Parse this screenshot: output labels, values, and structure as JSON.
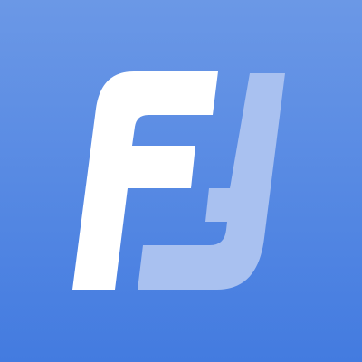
{
  "logo": {
    "name": "f-j-monogram-logo",
    "colors": {
      "background_top": "#6b98e6",
      "background_bottom": "#437be0",
      "f_glyph": "#ffffff",
      "j_glyph": "#a9c1f0"
    }
  }
}
